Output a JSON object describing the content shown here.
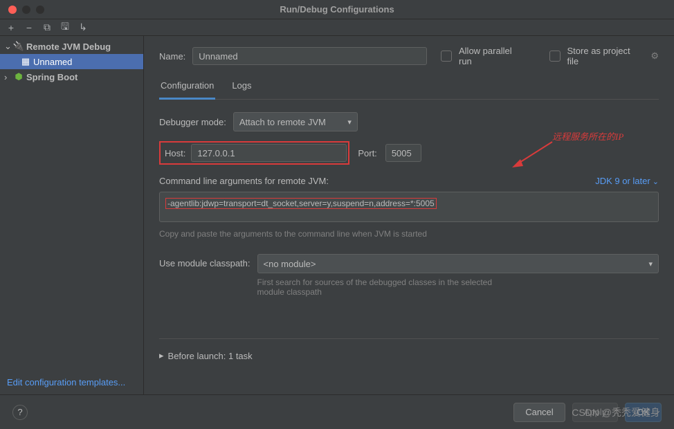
{
  "window": {
    "title": "Run/Debug Configurations"
  },
  "sidebar": {
    "items": [
      {
        "label": "Remote JVM Debug"
      },
      {
        "label": "Unnamed"
      },
      {
        "label": "Spring Boot"
      }
    ],
    "edit_templates": "Edit configuration templates..."
  },
  "header": {
    "name_label": "Name:",
    "name_value": "Unnamed",
    "allow_parallel": "Allow parallel run",
    "store_project": "Store as project file"
  },
  "tabs": {
    "configuration": "Configuration",
    "logs": "Logs"
  },
  "config": {
    "debugger_mode_label": "Debugger mode:",
    "debugger_mode_value": "Attach to remote JVM",
    "host_label": "Host:",
    "host_value": "127.0.0.1",
    "port_label": "Port:",
    "port_value": "5005",
    "cmd_label": "Command line arguments for remote JVM:",
    "jdk_link": "JDK 9 or later",
    "cmd_args": "-agentlib:jdwp=transport=dt_socket,server=y,suspend=n,address=*:5005",
    "cmd_hint": "Copy and paste the arguments to the command line when JVM is started",
    "module_label": "Use module classpath:",
    "module_value": "<no module>",
    "module_hint": "First search for sources of the debugged classes in the selected module classpath",
    "before_launch": "Before launch: 1 task"
  },
  "annotation": {
    "text": "远程服务所在的IP"
  },
  "footer": {
    "cancel": "Cancel",
    "apply": "Apply",
    "ok": "OK"
  },
  "watermark": "CSDN @秃秃爱健身"
}
